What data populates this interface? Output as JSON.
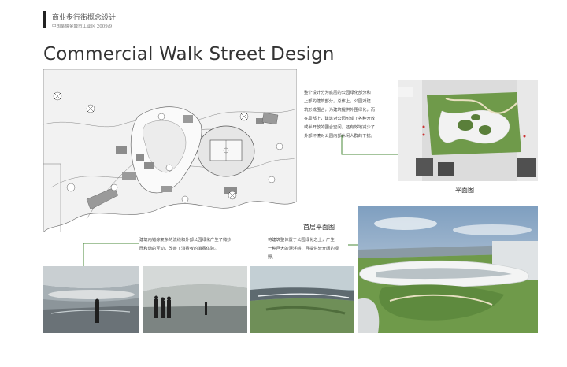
{
  "header": {
    "title_cn": "商业步行街概念设计",
    "subtitle": "中国某偃金城市工业区    2009/9"
  },
  "page_title": "Commercial Walk Street Design",
  "descriptions": {
    "overview": [
      "整个设计分为底层的公园绿化部分和",
      "上部的建筑部分。总体上，公园对建",
      "筑形成围合，为建筑提供外围绿化，而",
      "在局部上，建筑对公园形成了各种开放",
      "或半开放的围合空间，还有效地减少了",
      "外部环境对公园内部休闲人群的干扰。"
    ],
    "interior": [
      "建筑内错综复杂的流线和外部公园绿化产生了微妙",
      "而和谐的互动，改善了消费者的消费体验。"
    ],
    "elevated": [
      "将建筑整体置于公园绿化之上，产生",
      "一种巨大的漂浮感，且提供较开阔的视",
      "野。"
    ]
  },
  "captions": {
    "ground_floor_plan": "首层平面图",
    "site_plan": "平面图"
  },
  "colors": {
    "accent_line": "#4a8a3a",
    "lawn": "#6f9a4a",
    "sky": "#a9c0d8"
  }
}
